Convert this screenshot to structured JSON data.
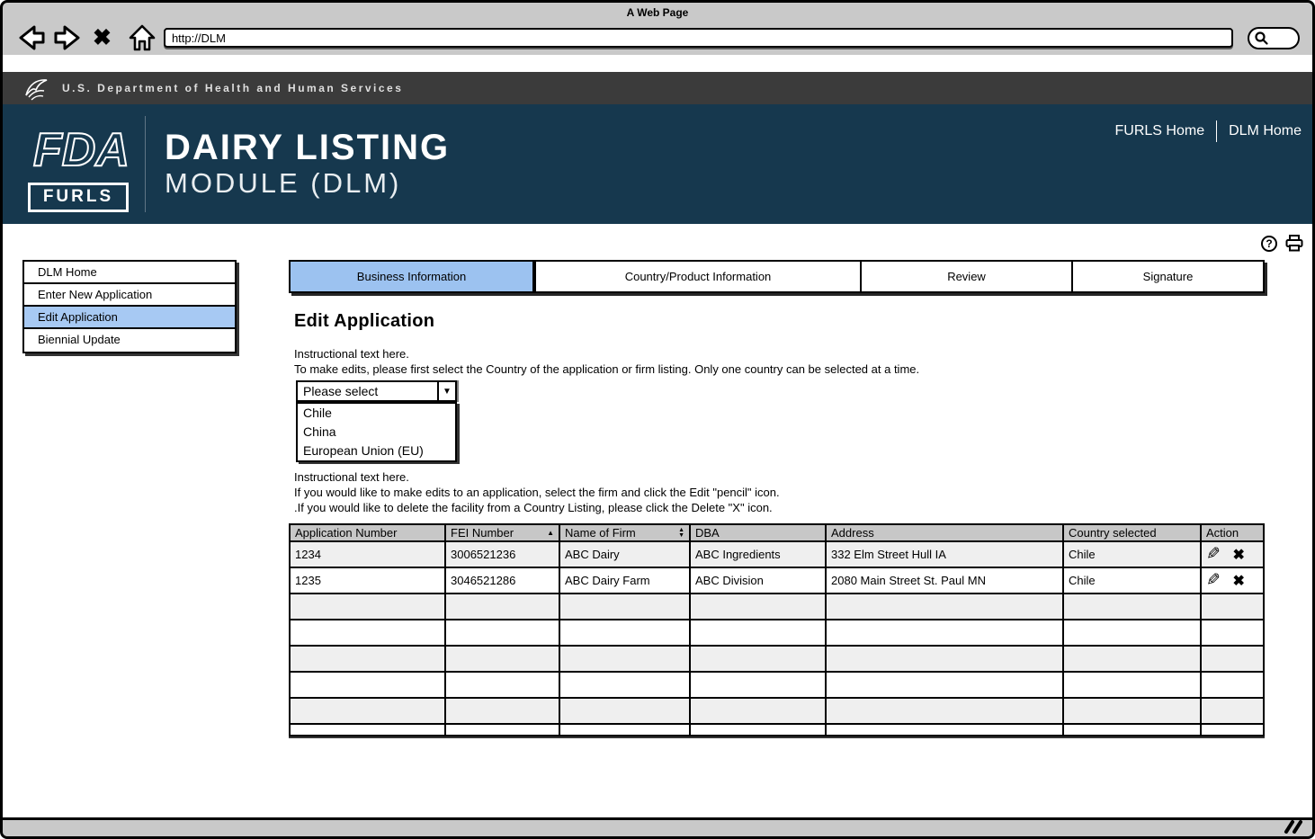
{
  "browser": {
    "title": "A Web Page",
    "url": "http://DLM"
  },
  "hhs_bar": {
    "text": "U.S. Department of Health and Human Services"
  },
  "header": {
    "logo_fda": "FDA",
    "logo_furls": "FURLS",
    "title_line1": "DAIRY LISTING",
    "title_line2": "MODULE (DLM)",
    "links": [
      {
        "label": "FURLS Home"
      },
      {
        "label": "DLM Home"
      }
    ]
  },
  "sidebar": {
    "items": [
      {
        "label": "DLM Home",
        "active": false
      },
      {
        "label": "Enter New Application",
        "active": false
      },
      {
        "label": "Edit Application",
        "active": true
      },
      {
        "label": "Biennial Update",
        "active": false
      }
    ]
  },
  "tabs": [
    {
      "label": "Business Information",
      "active": true
    },
    {
      "label": "Country/Product Information",
      "active": false
    },
    {
      "label": "Review",
      "active": false
    },
    {
      "label": "Signature",
      "active": false
    }
  ],
  "page": {
    "title": "Edit Application",
    "instructions1": [
      "Instructional text here.",
      "To make edits, please first select the Country of the application or firm listing. Only one country can be selected at a time."
    ],
    "instructions2": [
      "Instructional text here.",
      "If you would like to make edits to an application, select the firm and click the Edit \"pencil\" icon.",
      ".If you would like to delete the facility from a Country Listing, please click the Delete \"X\" icon."
    ]
  },
  "country_select": {
    "value": "Please select",
    "options": [
      "Chile",
      "China",
      "European Union (EU)"
    ]
  },
  "table": {
    "columns": [
      "Application Number",
      "FEI Number",
      "Name of Firm",
      "DBA",
      "Address",
      "Country selected",
      "Action"
    ],
    "sort": {
      "fei_number": "ascending",
      "name_of_firm": "sortable"
    },
    "rows": [
      {
        "application_number": "1234",
        "fei_number": "3006521236",
        "name_of_firm": "ABC Dairy",
        "dba": "ABC Ingredients",
        "address": "332 Elm Street Hull IA",
        "country": "Chile"
      },
      {
        "application_number": "1235",
        "fei_number": "3046521286",
        "name_of_firm": "ABC Dairy Farm",
        "dba": "ABC Division",
        "address": "2080 Main Street St. Paul MN",
        "country": "Chile"
      }
    ],
    "empty_rows": 6
  },
  "icons": {
    "close_glyph": "✖",
    "combo_arrow": "▼",
    "sort_asc": "▲",
    "sort_up": "▲",
    "sort_down": "▼",
    "edit_glyph": "✎",
    "delete_glyph": "✖",
    "help_glyph": "?"
  },
  "colors": {
    "accent_blue": "#9cc2f0",
    "sidebar_highlight": "#a7c9f3",
    "header_navy": "#16384e",
    "hhs_bar_gray": "#3b3b3b",
    "chrome_gray": "#c9c9c9",
    "table_header_gray": "#c7c7c7",
    "alt_row_gray": "#efefef"
  }
}
